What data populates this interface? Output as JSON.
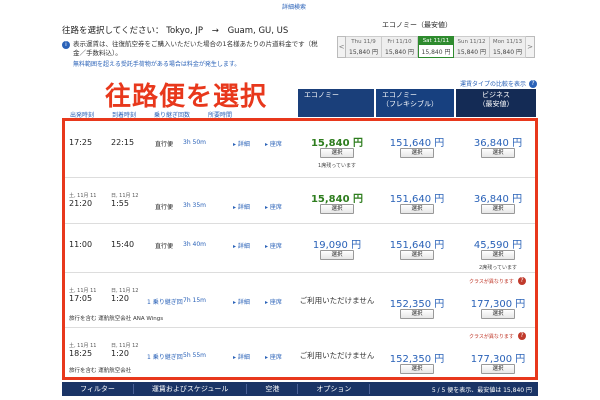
{
  "top_link": "詳細検索",
  "route": {
    "label": "往路を選択してください：",
    "origin": "Tokyo, JP",
    "arrow": "→",
    "destination": "Guam, GU, US",
    "note_icon": "i",
    "note": "表示運賃は、往復航空券をご購入いただいた場合の1名様あたりの片道料金です（税金／手数料込）。",
    "note2": "無料範囲を超える受託手荷物がある場合は料金が発生します。"
  },
  "calendar": {
    "title": "エコノミー（最安値）",
    "prev": "<",
    "next": ">",
    "days": [
      {
        "date": "Thu 11/9",
        "price": "15,840 円",
        "selected": false
      },
      {
        "date": "Fri 11/10",
        "price": "15,840 円",
        "selected": false
      },
      {
        "date": "Sat 11/11",
        "price": "15,840 円",
        "selected": true
      },
      {
        "date": "Sun 11/12",
        "price": "15,840 円",
        "selected": false
      },
      {
        "date": "Mon 11/13",
        "price": "15,840 円",
        "selected": false
      }
    ]
  },
  "compare_link": "運賃タイプの比較を表示",
  "big_title": "往路便を選択",
  "fare_headers": [
    {
      "line1": "エコノミー",
      "line2": ""
    },
    {
      "line1": "エコノミー",
      "line2": "（フレキシブル）"
    },
    {
      "line1": "ビジネス",
      "line2": "（最安値）"
    }
  ],
  "col_labels": [
    "出発時刻",
    "到着時刻",
    "乗り継ぎ回数",
    "所要時間"
  ],
  "select_label": "選択",
  "detail_label": "詳細",
  "seat_label": "座席",
  "flights": [
    {
      "dep_date": "",
      "dep": "17:25",
      "arr_date": "",
      "arr": "22:15",
      "stops": "直行便",
      "stops_link": false,
      "duration": "3h 50m",
      "econ": "15,840 円",
      "econ_cheap": true,
      "econ_avail": true,
      "econ_note": "1席残っています",
      "flex": "151,640 円",
      "biz": "36,840 円",
      "biz_note": "",
      "class_diff": "",
      "operator": ""
    },
    {
      "dep_date": "土, 11月 11",
      "dep": "21:20",
      "arr_date": "日, 11月 12",
      "arr": "1:55",
      "stops": "直行便",
      "stops_link": false,
      "duration": "3h 35m",
      "econ": "15,840 円",
      "econ_cheap": true,
      "econ_avail": true,
      "econ_note": "",
      "flex": "151,640 円",
      "biz": "36,840 円",
      "biz_note": "",
      "class_diff": "",
      "operator": ""
    },
    {
      "dep_date": "",
      "dep": "11:00",
      "arr_date": "",
      "arr": "15:40",
      "stops": "直行便",
      "stops_link": false,
      "duration": "3h 40m",
      "econ": "19,090 円",
      "econ_cheap": false,
      "econ_avail": true,
      "econ_note": "",
      "flex": "151,640 円",
      "biz": "45,590 円",
      "biz_note": "2席残っています",
      "class_diff": "",
      "operator": ""
    },
    {
      "dep_date": "土, 11月 11",
      "dep": "17:05",
      "arr_date": "日, 11月 12",
      "arr": "1:20",
      "stops": "1 乗り継ぎ回",
      "stops_link": true,
      "duration": "7h 15m",
      "econ": "ご利用いただけません",
      "econ_cheap": false,
      "econ_avail": false,
      "econ_note": "",
      "flex": "152,350 円",
      "biz": "177,300 円",
      "biz_note": "",
      "class_diff": "クラスが異なります",
      "operator": "旅行を含む 運航航空会社 ANA Wings"
    },
    {
      "dep_date": "土, 11月 11",
      "dep": "18:25",
      "arr_date": "日, 11月 12",
      "arr": "1:20",
      "stops": "1 乗り継ぎ回",
      "stops_link": true,
      "duration": "5h 55m",
      "econ": "ご利用いただけません",
      "econ_cheap": false,
      "econ_avail": false,
      "econ_note": "",
      "flex": "152,350 円",
      "biz": "177,300 円",
      "biz_note": "",
      "class_diff": "クラスが異なります",
      "operator": "旅行を含む 運航航空会社"
    }
  ],
  "filter_bar": {
    "items": [
      "フィルター",
      "運賃およびスケジュール",
      "空港",
      "オプション"
    ],
    "summary": "5 / 5 便を表示、最安値は 15,840 円"
  },
  "colors": {
    "navy": "#1a3f7a",
    "accent_red": "#e8381c",
    "green": "#2e8b2e",
    "link": "#2a62b8"
  }
}
